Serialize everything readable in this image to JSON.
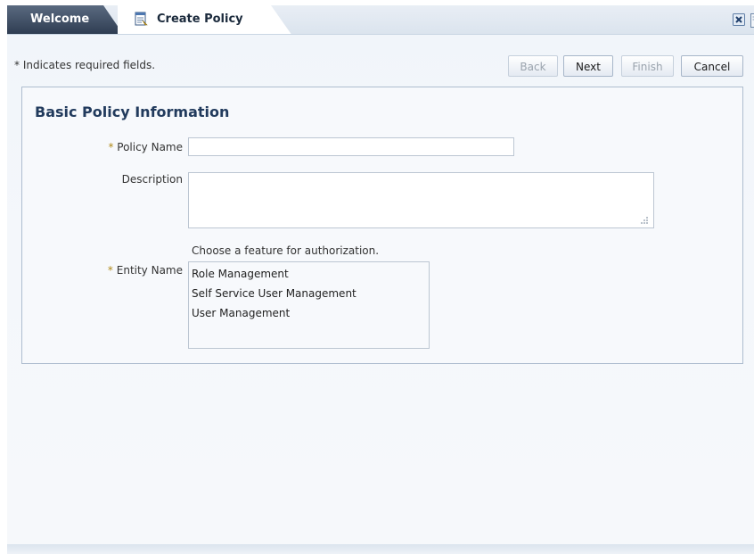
{
  "tabs": {
    "welcome_label": "Welcome",
    "create_label": "Create Policy"
  },
  "toolbar": {
    "required_note": "* Indicates required fields.",
    "back_label": "Back",
    "next_label": "Next",
    "finish_label": "Finish",
    "cancel_label": "Cancel"
  },
  "section": {
    "title": "Basic Policy Information"
  },
  "form": {
    "policy_name_label": "Policy Name",
    "policy_name_value": "",
    "description_label": "Description",
    "description_value": "",
    "entity_hint": "Choose a feature for authorization.",
    "entity_name_label": "Entity Name",
    "required_marker": "*",
    "entities": [
      "Role Management",
      "Self Service User Management",
      "User Management"
    ]
  },
  "colors": {
    "accent": "#223b5d",
    "required_star": "#b08a1a",
    "tab_dark": "#2f3d52"
  }
}
